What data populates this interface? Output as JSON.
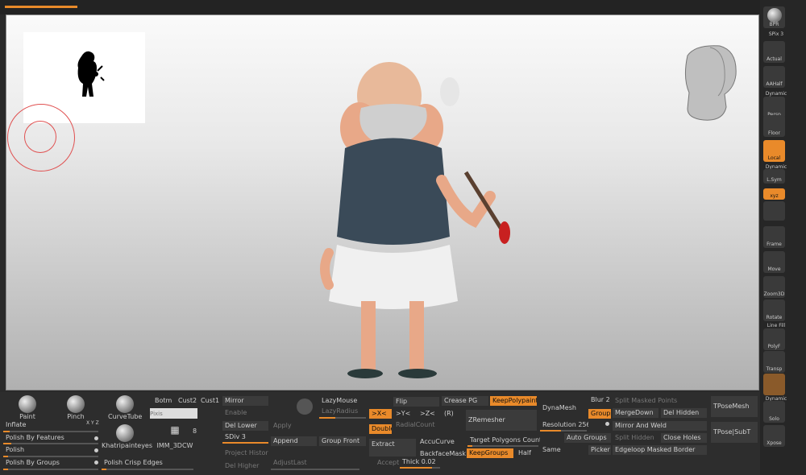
{
  "right_shelf": {
    "bpr": "BPR",
    "spix": "SPix 3",
    "actual": "Actual",
    "aahalf": "AAHalf",
    "dynamic1": "Dynamic",
    "persp": "Persp",
    "floor": "Floor",
    "local": "Local",
    "dynamic2": "Dynamic",
    "lsym": "L.Sym",
    "xyz": "xyz",
    "frame": "Frame",
    "move": "Move",
    "zoom3d": "Zoom3D",
    "rotate": "Rotate",
    "linefill": "Line Fill",
    "polyf": "PolyF",
    "transp": "Transp",
    "dynamic3": "Dynamic",
    "solo": "Solo",
    "xpose": "Xpose"
  },
  "brushes": {
    "paint": "Paint",
    "pinch": "Pinch",
    "curvetube": "CurveTube",
    "khatri": "Khatripainteyes",
    "imm": "IMM_3DCW",
    "imm_count": "8",
    "botm": "Botm",
    "cust2": "Cust2",
    "cust1": "Cust1",
    "search_placeholder": "Pixis"
  },
  "deform": {
    "inflate": "Inflate",
    "inflate_axes": "X Y Z",
    "polish_features": "Polish By Features",
    "polish": "Polish",
    "polish_groups": "Polish By Groups",
    "polish_crisp": "Polish Crisp Edges"
  },
  "subtool": {
    "mirror": "Mirror",
    "enable": "Enable",
    "del_lower": "Del Lower",
    "apply": "Apply",
    "sdiv": "SDiv 3",
    "append": "Append",
    "project_history": "Project History",
    "del_higher": "Del Higher",
    "adjust_last": "AdjustLast"
  },
  "lazy": {
    "lazymouse": "LazyMouse",
    "lazyradius": "LazyRadius",
    "group_front": "Group Front"
  },
  "symmetry": {
    "x": ">X<",
    "y": ">Y<",
    "z": ">Z<",
    "r": "(R)",
    "flip": "Flip",
    "radialcount": "RadialCount",
    "double": "Double",
    "extract": "Extract",
    "accucurve": "AccuCurve",
    "backfacemask": "BackfaceMask",
    "accept": "Accept",
    "thick": "Thick 0.02"
  },
  "remesh": {
    "crease_pg": "Crease PG",
    "keeppolypaint": "KeepPolypaint",
    "zremesher": "ZRemesher",
    "target": "Target Polygons Count 5",
    "keepgroups": "KeepGroups",
    "half": "Half",
    "same": "Same"
  },
  "dynamesh": {
    "dynamesh": "DynaMesh",
    "resolution": "Resolution 256",
    "blur": "Blur 2",
    "groups": "Groups",
    "auto_groups": "Auto Groups",
    "picker": "Picker"
  },
  "split": {
    "split_masked": "Split Masked Points",
    "mergedown": "MergeDown",
    "del_hidden": "Del Hidden",
    "mirror_weld": "Mirror And Weld",
    "split_hidden": "Split Hidden",
    "close_holes": "Close Holes",
    "edgeloop": "Edgeloop Masked Border"
  },
  "tpose": {
    "tposemesh": "TPoseMesh",
    "tpose_subt": "TPose|SubT"
  },
  "colors": {
    "accent": "#e98a2a",
    "panel": "#2d2d2d",
    "button": "#3b3b3b"
  }
}
